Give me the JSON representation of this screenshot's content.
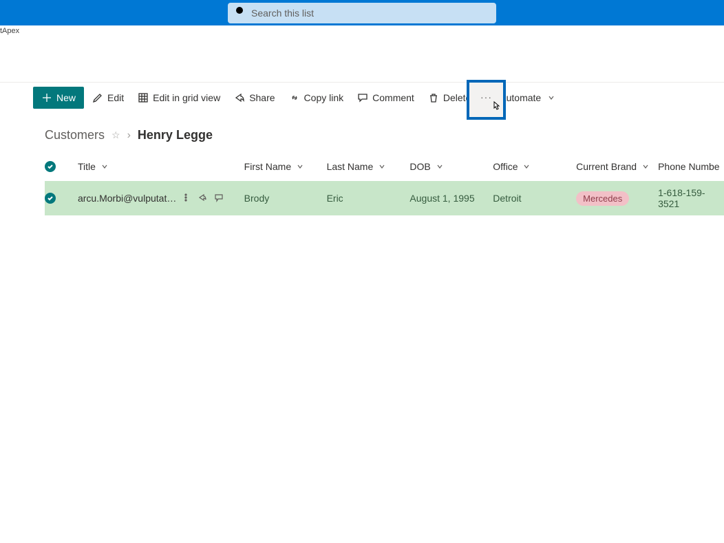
{
  "app": {
    "sub_label": "tApex"
  },
  "search": {
    "placeholder": "Search this list"
  },
  "toolbar": {
    "new": "New",
    "edit": "Edit",
    "grid": "Edit in grid view",
    "share": "Share",
    "copy": "Copy link",
    "comment": "Comment",
    "delete": "Delete",
    "automate": "Automate",
    "more": "···"
  },
  "breadcrumb": {
    "root": "Customers",
    "current": "Henry Legge"
  },
  "columns": {
    "title": "Title",
    "first_name": "First Name",
    "last_name": "Last Name",
    "dob": "DOB",
    "office": "Office",
    "brand": "Current Brand",
    "phone": "Phone Numbe"
  },
  "rows": [
    {
      "title": "arcu.Morbi@vulputatedu...",
      "first_name": "Brody",
      "last_name": "Eric",
      "dob": "August 1, 1995",
      "office": "Detroit",
      "brand": "Mercedes",
      "phone": "1-618-159-3521"
    }
  ]
}
